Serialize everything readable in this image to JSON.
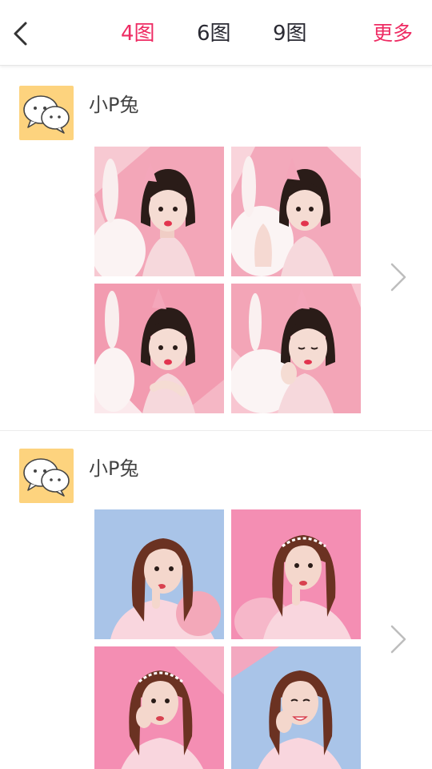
{
  "header": {
    "tabs": [
      {
        "label": "4图",
        "active": true
      },
      {
        "label": "6图",
        "active": false
      },
      {
        "label": "9图",
        "active": false
      }
    ],
    "more_label": "更多",
    "accent_color": "#ee2b63"
  },
  "posts": [
    {
      "username": "小P兔",
      "avatar_icon": "wechat-bubbles-icon",
      "photo_style": "pink-bob-bunny",
      "photo_count": 4
    },
    {
      "username": "小P兔",
      "avatar_icon": "wechat-bubbles-icon",
      "photo_style": "wavy-hair-pastel",
      "photo_count": 4
    }
  ]
}
